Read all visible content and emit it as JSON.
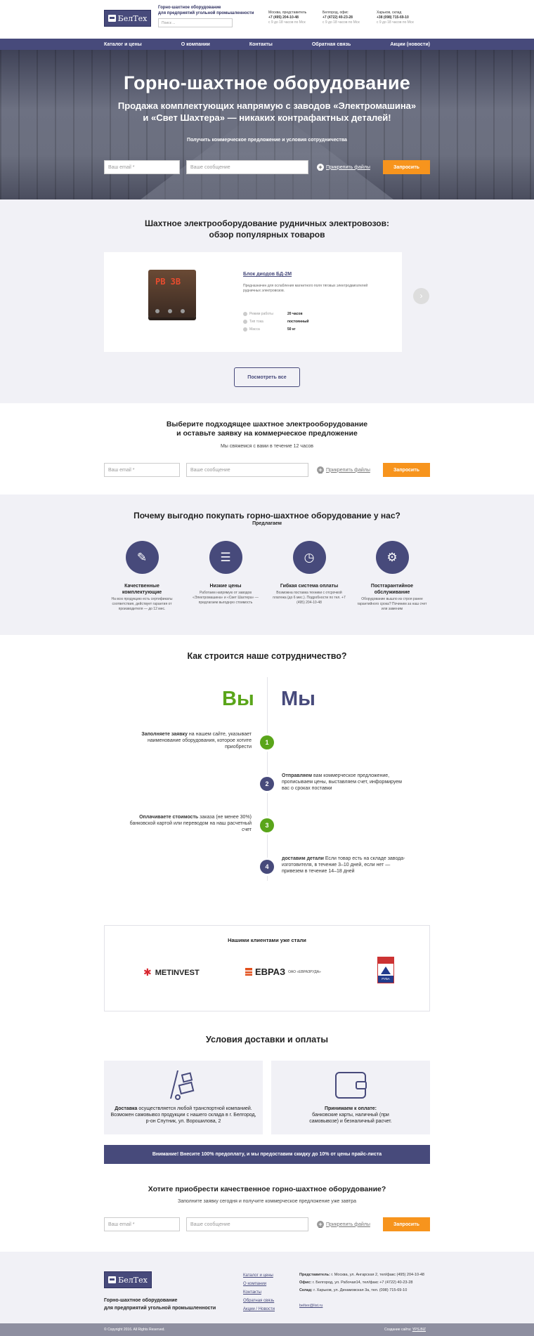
{
  "header": {
    "logo_text": "БелТех",
    "tagline_1": "Горно-шахтное оборудование",
    "tagline_2": "для предприятий угольной промышленности",
    "search_placeholder": "Поиск ...",
    "contacts": [
      {
        "city": "Москва, представитель",
        "phone": "+7 (495) 204-10-48",
        "hours": "с 9 до 18 часов по Мск"
      },
      {
        "city": "Белгород, офис",
        "phone": "+7 (4722) 40-23-28",
        "hours": "с 9 до 18 часов по Мск"
      },
      {
        "city": "Харьков, склад",
        "phone": "+38 (098) 715-69-10",
        "hours": "с 9 до 18 часов по Мск"
      }
    ]
  },
  "nav": [
    "Каталог и цены",
    "О компании",
    "Контакты",
    "Обратная связь",
    "Акции (новости)"
  ],
  "hero": {
    "title": "Горно-шахтное оборудование",
    "subtitle_1": "Продажа комплектующих напрямую с заводов «Электромашина»",
    "subtitle_2": "и «Свет Шахтера» — никаких контрафактных деталей!",
    "cta_text": "Получить коммерческое предложение и условия сотрудничества"
  },
  "form": {
    "email_placeholder": "Ваш email *",
    "message_placeholder": "Ваше сообщение",
    "attach_label": "Прикрепить файлы",
    "submit_label": "Запросить"
  },
  "products": {
    "heading_1": "Шахтное электрооборудование рудничных электровозов:",
    "heading_2": "обзор популярных товаров",
    "device_label": "PB 3B",
    "item_title": "Блок диодов БД-2М",
    "item_desc": "Предназначен для ослабления магнитного поля тяговых электродвигателей рудничных электровозов.",
    "specs": [
      {
        "key": "Режим работы",
        "value": "20 часов"
      },
      {
        "key": "Тип тока",
        "value": "постоянный"
      },
      {
        "key": "Масса",
        "value": "50 кг"
      }
    ],
    "see_all": "Посмотреть все",
    "prev": "‹",
    "next": "›"
  },
  "choose": {
    "heading_1": "Выберите подходящее шахтное электрооборудование",
    "heading_2": "и оставьте заявку на коммерческое предложение",
    "note": "Мы свяжемся с вами в течение 12 часов"
  },
  "why": {
    "heading": "Почему выгодно покупать горно-шахтное оборудование у нас?",
    "sub": "Предлагаем",
    "features": [
      {
        "title_1": "Качественные",
        "title_2": "комплектующие",
        "text": "На всю продукцию есть сертификаты соответствия, действует гарантия от производителя — до 12 мес."
      },
      {
        "title_1": "Низкие цены",
        "title_2": "",
        "text": "Работаем напрямую от заводов «Электромашина» и «Свет Шахтера» — предлагаем выгодную стоимость"
      },
      {
        "title_1": "Гибкая система оплаты",
        "title_2": "",
        "text": "Возможна поставка техники с отсрочкой платежа (до 6 мес.). Подробности по тел. +7 (495) 204-10-48"
      },
      {
        "title_1": "Постгарантийное",
        "title_2": "обслуживание",
        "text": "Оборудование вышло из строя ранее гарантийного срока? Починим за наш счет или заменим"
      }
    ]
  },
  "coop": {
    "heading": "Как строится наше сотрудничество?",
    "you": "Вы",
    "we": "Мы",
    "steps": [
      {
        "n": "1",
        "bold": "Заполняете заявку",
        "text": "на нашем сайте, указывает наименование оборудования, которое хотите приобрести"
      },
      {
        "n": "2",
        "bold": "Отправляем",
        "text": "вам коммерческое предложение, прописываем цены, выставляем счет, информируем вас о сроках поставки"
      },
      {
        "n": "3",
        "bold": "Оплачиваете стоимость",
        "text": "заказа (не менее 30%) банковской картой или переводом на наш расчетный счет"
      },
      {
        "n": "4",
        "bold": "доставим детали",
        "text": "Если товар есть на складе завода-изготовителя, в течение 3–10 дней, если нет — привезем в течение 14–18 дней"
      }
    ]
  },
  "clients": {
    "heading": "Нашими клиентами уже стали",
    "logos": [
      "METINVEST",
      "ЕВРАЗ",
      "ОАО «ЕВРАЗРУДА»",
      "РУБА"
    ]
  },
  "delivery": {
    "heading": "Условия доставки и оплаты",
    "left_bold": "Доставка",
    "left_text": "осуществляется любой транспортной компанией. Возможен самовывоз продукции с нашего склада в г. Белгород, р-он Спутник, ул. Ворошилова, 2",
    "right_bold": "Принимаем к оплате:",
    "right_text": "банковские карты, наличный (при самовывозе) и безналичный расчет.",
    "notice": "Внимание! Внесите 100% предоплату, и мы предоставим скидку до 10% от цены прайс-листа"
  },
  "final": {
    "heading": "Хотите приобрести качественное горно-шахтное оборудование?",
    "note": "Заполните заявку сегодня и получите коммерческое предложение уже завтра"
  },
  "footer": {
    "tagline_1": "Горно-шахтное оборудование",
    "tagline_2": "для предприятий угольной промышленности",
    "links": [
      "Каталог и цены",
      "О компании",
      "Контакты",
      "Обратная связь",
      "Акции / Новости"
    ],
    "info": [
      {
        "label": "Представитель:",
        "text": "г. Москва, ул. Ангарская 2, тел/факс (495) 204-10-48"
      },
      {
        "label": "Офис:",
        "text": "г. Белгород, ул. Рабочая14, тел/факс +7 (4722) 40-23-28"
      },
      {
        "label": "Склад:",
        "text": "г. Харьков, ул. Динамовская 3а, тел. (098) 715-69-10"
      }
    ],
    "email": "beltex@list.ru",
    "copyright": "© Copyright 2016. All Rights Reserved.",
    "created_label": "Создание сайта:",
    "created_link": "YPS.BIZ"
  },
  "colors": {
    "brand": "#474a7b",
    "accent": "#f7941d",
    "green": "#5aa51a"
  }
}
